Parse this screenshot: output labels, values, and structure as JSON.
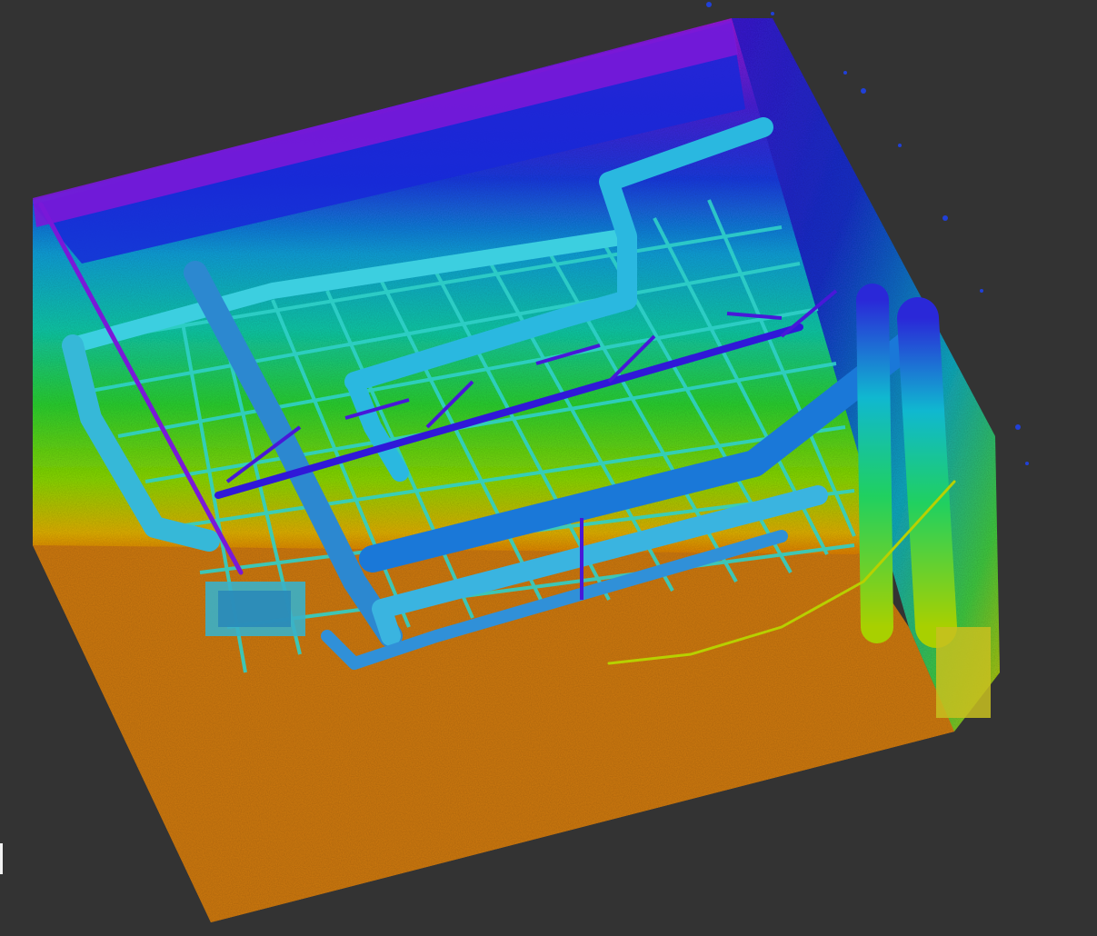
{
  "viewer": {
    "background_color": "#333333",
    "colormap": [
      "#ff8000",
      "#b5d800",
      "#2fd82a",
      "#00c8c8",
      "#1560e0",
      "#2d10d0",
      "#8a16d6"
    ],
    "colormap_name": "height-rainbow"
  }
}
